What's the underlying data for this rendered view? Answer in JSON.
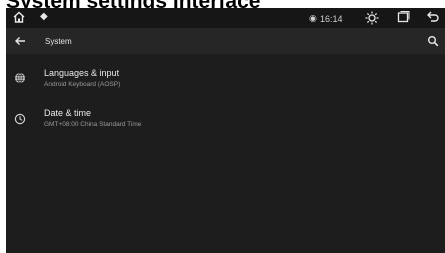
{
  "caption": "System settings interface",
  "status_bar": {
    "home_icon": "home-icon",
    "usb_icon": "usb-icon",
    "location_icon": "location-icon",
    "time": "16:14",
    "brightness_icon": "brightness-icon",
    "recents_icon": "recents-icon",
    "back_icon": "back-icon"
  },
  "toolbar": {
    "title": "System",
    "back_icon": "arrow-back-icon",
    "search_icon": "search-icon"
  },
  "settings": [
    {
      "title": "Languages & input",
      "subtitle": "Android Keyboard (AOSP)",
      "icon": "globe-icon"
    },
    {
      "title": "Date & time",
      "subtitle": "GMT+08:00 China Standard Time",
      "icon": "clock-icon"
    }
  ],
  "colors": {
    "background": "#1d1d1d",
    "toolbar": "#262626",
    "text_primary": "#eaeaea",
    "text_secondary": "#9a9a9a"
  }
}
